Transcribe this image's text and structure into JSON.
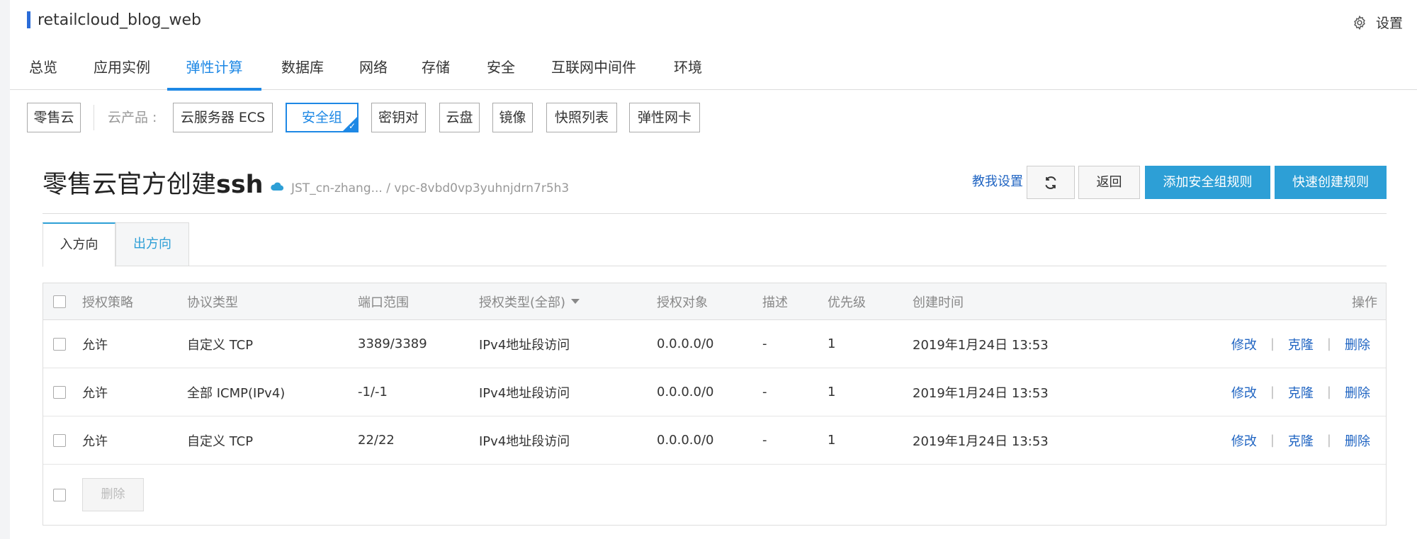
{
  "app": {
    "title": "retailcloud_blog_web",
    "settings_label": "设置"
  },
  "topnav": {
    "tabs": [
      {
        "label": "总览"
      },
      {
        "label": "应用实例"
      },
      {
        "label": "弹性计算",
        "active": true
      },
      {
        "label": "数据库"
      },
      {
        "label": "网络"
      },
      {
        "label": "存储"
      },
      {
        "label": "安全"
      },
      {
        "label": "互联网中间件"
      },
      {
        "label": "环境"
      }
    ]
  },
  "products": {
    "home_chip": "零售云",
    "label": "云产品 :",
    "chips": [
      {
        "label": "云服务器 ECS"
      },
      {
        "label": "安全组",
        "selected": true
      },
      {
        "label": "密钥对"
      },
      {
        "label": "云盘"
      },
      {
        "label": "镜像"
      },
      {
        "label": "快照列表"
      },
      {
        "label": "弹性网卡"
      }
    ]
  },
  "page": {
    "title_prefix": "零售云官方创建",
    "title_suffix": "ssh",
    "path": "JST_cn-zhang... / vpc-8vbd0vp3yuhnjdrn7r5h3",
    "teach_link": "教我设置",
    "refresh_icon": "refresh-icon",
    "back_label": "返回",
    "add_rule_label": "添加安全组规则",
    "quick_create_label": "快速创建规则"
  },
  "direction_tabs": [
    {
      "label": "入方向",
      "active": true
    },
    {
      "label": "出方向",
      "active": false
    }
  ],
  "table": {
    "headers": {
      "policy": "授权策略",
      "protocol": "协议类型",
      "port": "端口范围",
      "auth_type": "授权类型(全部)",
      "auth_object": "授权对象",
      "desc": "描述",
      "priority": "优先级",
      "created": "创建时间",
      "actions": "操作"
    },
    "rows": [
      {
        "policy": "允许",
        "protocol": "自定义 TCP",
        "port": "3389/3389",
        "auth_type": "IPv4地址段访问",
        "auth_object": "0.0.0.0/0",
        "desc": "-",
        "priority": "1",
        "created": "2019年1月24日 13:53"
      },
      {
        "policy": "允许",
        "protocol": "全部 ICMP(IPv4)",
        "port": "-1/-1",
        "auth_type": "IPv4地址段访问",
        "auth_object": "0.0.0.0/0",
        "desc": "-",
        "priority": "1",
        "created": "2019年1月24日 13:53"
      },
      {
        "policy": "允许",
        "protocol": "自定义 TCP",
        "port": "22/22",
        "auth_type": "IPv4地址段访问",
        "auth_object": "0.0.0.0/0",
        "desc": "-",
        "priority": "1",
        "created": "2019年1月24日 13:53"
      }
    ],
    "row_actions": {
      "edit": "修改",
      "clone": "克隆",
      "delete": "删除",
      "separator": "|"
    },
    "bulk_delete_label": "删除"
  },
  "colors": {
    "accent": "#1e88e5",
    "primary_button": "#2d9fd6",
    "link": "#1f64c2",
    "title_bar": "#2b6cd8"
  }
}
